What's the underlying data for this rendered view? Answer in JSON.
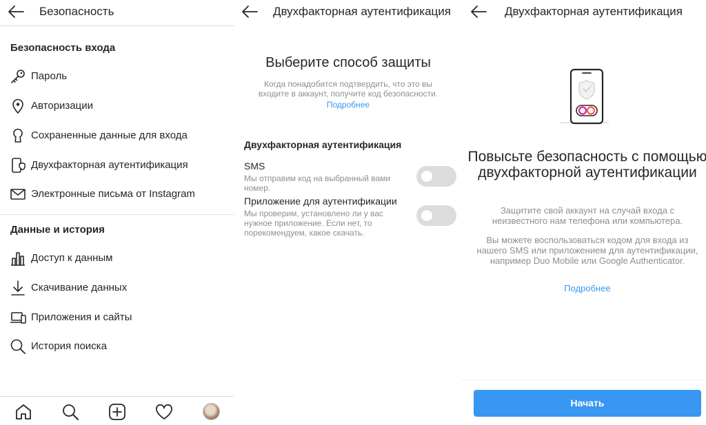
{
  "panel1": {
    "header_title": "Безопасность",
    "section1_title": "Безопасность входа",
    "section1_items": [
      {
        "label": "Пароль",
        "icon": "key-icon"
      },
      {
        "label": "Авторизации",
        "icon": "location-pin-icon"
      },
      {
        "label": "Сохраненные данные для входа",
        "icon": "keyhole-icon"
      },
      {
        "label": "Двухфакторная аутентификация",
        "icon": "phone-shield-icon"
      },
      {
        "label": "Электронные письма от Instagram",
        "icon": "envelope-icon"
      }
    ],
    "section2_title": "Данные и история",
    "section2_items": [
      {
        "label": "Доступ к данным",
        "icon": "bar-chart-icon"
      },
      {
        "label": "Скачивание данных",
        "icon": "download-icon"
      },
      {
        "label": "Приложения и сайты",
        "icon": "laptop-icon"
      },
      {
        "label": "История поиска",
        "icon": "search-icon"
      }
    ],
    "tabbar": [
      "home-icon",
      "search-icon",
      "add-post-icon",
      "heart-icon",
      "profile-avatar"
    ]
  },
  "panel2": {
    "header_title": "Двухфакторная аутентификация",
    "heading": "Выберите способ защиты",
    "description": "Когда понадобится подтвердить, что это вы входите в аккаунт, получите код безопасности.",
    "learn_more": "Подробнее",
    "subheading": "Двухфакторная аутентификация",
    "options": [
      {
        "title": "SMS",
        "description": "Мы отправим код на выбранный вами номер.",
        "enabled": false
      },
      {
        "title": "Приложение для аутентификации",
        "description": "Мы проверим, установлено ли у вас нужное приложение. Если нет, то порекомендуем, какое скачать.",
        "enabled": false
      }
    ]
  },
  "panel3": {
    "header_title": "Двухфакторная аутентификация",
    "heading": "Повысьте безопасность с помощью двухфакторной аутентификации",
    "description1": "Защитите свой аккаунт на случай входа с неизвестного нам телефона или компьютера.",
    "description2": "Вы можете воспользоваться кодом для входа из нашего SMS или приложением для аутентификации, например Duo Mobile или Google Authenticator.",
    "learn_more": "Подробнее",
    "start_button": "Начать"
  },
  "colors": {
    "accent": "#3897f0",
    "text": "#262626",
    "secondary_text": "#8e8e8e",
    "toggle_off": "#dcdcdc"
  }
}
